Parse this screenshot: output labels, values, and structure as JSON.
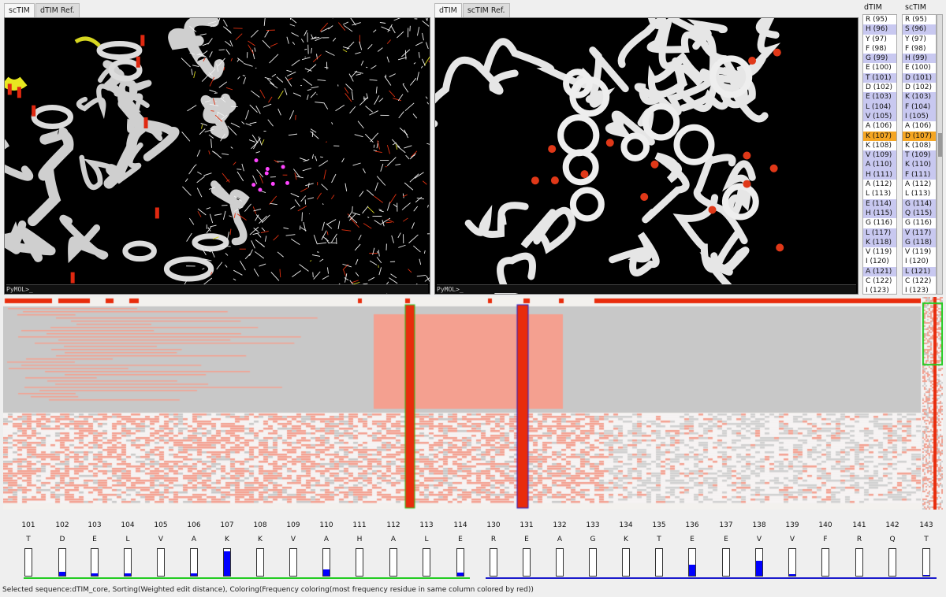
{
  "left_panel": {
    "tabs": [
      "scTIM",
      "dTIM Ref."
    ],
    "active_tab": 0,
    "prompt": "PyMOL>_"
  },
  "right_panel": {
    "tabs": [
      "dTIM",
      "scTIM Ref."
    ],
    "active_tab": 0,
    "prompt": "PyMOL>_"
  },
  "sequence_lists": {
    "dtim_header": "dTIM",
    "sctim_header": "scTIM",
    "rows": [
      {
        "dtim": "R (95)",
        "sctim": "R (95)",
        "hl": false
      },
      {
        "dtim": "H (96)",
        "sctim": "S (96)",
        "hl": true
      },
      {
        "dtim": "Y (97)",
        "sctim": "Y (97)",
        "hl": false
      },
      {
        "dtim": "F (98)",
        "sctim": "F (98)",
        "hl": false
      },
      {
        "dtim": "G (99)",
        "sctim": "H (99)",
        "hl": true
      },
      {
        "dtim": "E (100)",
        "sctim": "E (100)",
        "hl": false
      },
      {
        "dtim": "T (101)",
        "sctim": "D (101)",
        "hl": true
      },
      {
        "dtim": "D (102)",
        "sctim": "D (102)",
        "hl": false
      },
      {
        "dtim": "E (103)",
        "sctim": "K (103)",
        "hl": true
      },
      {
        "dtim": "L (104)",
        "sctim": "F (104)",
        "hl": true
      },
      {
        "dtim": "V (105)",
        "sctim": "I (105)",
        "hl": true
      },
      {
        "dtim": "A (106)",
        "sctim": "A (106)",
        "hl": false
      },
      {
        "dtim": "K (107)",
        "sctim": "D (107)",
        "hl": true,
        "selected": true
      },
      {
        "dtim": "K (108)",
        "sctim": "K (108)",
        "hl": false
      },
      {
        "dtim": "V (109)",
        "sctim": "T (109)",
        "hl": true
      },
      {
        "dtim": "A (110)",
        "sctim": "K (110)",
        "hl": true
      },
      {
        "dtim": "H (111)",
        "sctim": "F (111)",
        "hl": true
      },
      {
        "dtim": "A (112)",
        "sctim": "A (112)",
        "hl": false
      },
      {
        "dtim": "L (113)",
        "sctim": "L (113)",
        "hl": false
      },
      {
        "dtim": "E (114)",
        "sctim": "G (114)",
        "hl": true
      },
      {
        "dtim": "H (115)",
        "sctim": "Q (115)",
        "hl": true
      },
      {
        "dtim": "G (116)",
        "sctim": "G (116)",
        "hl": false
      },
      {
        "dtim": "L (117)",
        "sctim": "V (117)",
        "hl": true
      },
      {
        "dtim": "K (118)",
        "sctim": "G (118)",
        "hl": true
      },
      {
        "dtim": "V (119)",
        "sctim": "V (119)",
        "hl": false
      },
      {
        "dtim": "I (120)",
        "sctim": "I (120)",
        "hl": false
      },
      {
        "dtim": "A (121)",
        "sctim": "L (121)",
        "hl": true
      },
      {
        "dtim": "C (122)",
        "sctim": "C (122)",
        "hl": false
      },
      {
        "dtim": "I (123)",
        "sctim": "I (123)",
        "hl": false
      }
    ]
  },
  "positions": [
    {
      "num": "101",
      "res": "T",
      "freq": 0.0
    },
    {
      "num": "102",
      "res": "D",
      "freq": 0.15
    },
    {
      "num": "103",
      "res": "E",
      "freq": 0.08
    },
    {
      "num": "104",
      "res": "L",
      "freq": 0.08
    },
    {
      "num": "105",
      "res": "V",
      "freq": 0.0
    },
    {
      "num": "106",
      "res": "A",
      "freq": 0.1
    },
    {
      "num": "107",
      "res": "K",
      "freq": 0.92
    },
    {
      "num": "108",
      "res": "K",
      "freq": 0.0
    },
    {
      "num": "109",
      "res": "V",
      "freq": 0.0
    },
    {
      "num": "110",
      "res": "A",
      "freq": 0.25
    },
    {
      "num": "111",
      "res": "H",
      "freq": 0.0
    },
    {
      "num": "112",
      "res": "A",
      "freq": 0.0
    },
    {
      "num": "113",
      "res": "L",
      "freq": 0.0
    },
    {
      "num": "114",
      "res": "E",
      "freq": 0.12
    },
    {
      "num": "130",
      "res": "R",
      "freq": 0.0
    },
    {
      "num": "131",
      "res": "E",
      "freq": 0.0
    },
    {
      "num": "132",
      "res": "A",
      "freq": 0.0
    },
    {
      "num": "133",
      "res": "G",
      "freq": 0.0
    },
    {
      "num": "134",
      "res": "K",
      "freq": 0.0
    },
    {
      "num": "135",
      "res": "T",
      "freq": 0.0
    },
    {
      "num": "136",
      "res": "E",
      "freq": 0.42
    },
    {
      "num": "137",
      "res": "E",
      "freq": 0.0
    },
    {
      "num": "138",
      "res": "V",
      "freq": 0.55
    },
    {
      "num": "139",
      "res": "V",
      "freq": 0.05
    },
    {
      "num": "140",
      "res": "F",
      "freq": 0.0
    },
    {
      "num": "141",
      "res": "R",
      "freq": 0.0
    },
    {
      "num": "142",
      "res": "Q",
      "freq": 0.0
    },
    {
      "num": "143",
      "res": "T",
      "freq": 0.03
    }
  ],
  "colors": {
    "highlight": "#c8c8f0",
    "selected": "#f5a623",
    "match": "#f4a090",
    "gap": "#c8c8c8",
    "conserved": "#e82c0c",
    "group1_underline": "#22cc22",
    "group2_underline": "#1a1acc"
  },
  "status": "Selected sequence:dTIM_core, Sorting(Weighted edit distance), Coloring(Frequency coloring(most frequency residue in same column colored by red))"
}
